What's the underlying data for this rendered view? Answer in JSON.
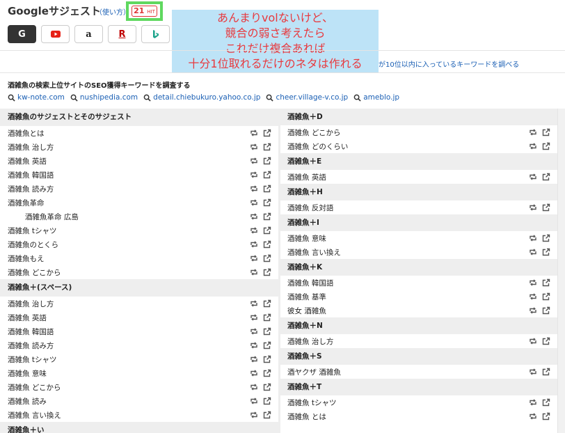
{
  "header": {
    "title": "Googleサジェスト",
    "howto": "（使い方）",
    "hit_count": "21",
    "hit_unit": "HIT"
  },
  "engines": [
    {
      "name": "google",
      "label": "G"
    },
    {
      "name": "youtube",
      "label": ""
    },
    {
      "name": "amazon",
      "label": "a"
    },
    {
      "name": "rakuten",
      "label": "R"
    },
    {
      "name": "bing",
      "label": ""
    }
  ],
  "callout": {
    "lines": [
      "あんまりvolないけど、",
      "競合の弱さ考えたら",
      "これだけ複合あれば",
      "十分1位取れるだけのネタは作れる"
    ]
  },
  "subline": {
    "text": "が10位以内に入っているキーワードを調べる"
  },
  "seo": {
    "title": "酒雑魚の検索上位サイトのSEO獲得キーワードを調査する",
    "sites": [
      "kw-note.com",
      "nushipedia.com",
      "detail.chiebukuro.yahoo.co.jp",
      "cheer.village-v.co.jp",
      "ameblo.jp"
    ]
  },
  "left": {
    "sections": [
      {
        "title": "酒雑魚のサジェストとそのサジェスト",
        "items": [
          {
            "text": "酒雑魚とは"
          },
          {
            "text": "酒雑魚 治し方"
          },
          {
            "text": "酒雑魚 英語"
          },
          {
            "text": "酒雑魚 韓国語"
          },
          {
            "text": "酒雑魚 読み方"
          },
          {
            "text": "酒雑魚革命"
          },
          {
            "text": "酒雑魚革命 広島",
            "indent": true
          },
          {
            "text": "酒雑魚 tシャツ"
          },
          {
            "text": "酒雑魚のとくら"
          },
          {
            "text": "酒雑魚もえ"
          },
          {
            "text": "酒雑魚 どこから"
          }
        ]
      },
      {
        "title": "酒雑魚＋(スペース)",
        "items": [
          {
            "text": "酒雑魚 治し方"
          },
          {
            "text": "酒雑魚 英語"
          },
          {
            "text": "酒雑魚 韓国語"
          },
          {
            "text": "酒雑魚 読み方"
          },
          {
            "text": "酒雑魚 tシャツ"
          },
          {
            "text": "酒雑魚 意味"
          },
          {
            "text": "酒雑魚 どこから"
          },
          {
            "text": "酒雑魚 読み"
          },
          {
            "text": "酒雑魚 言い換え"
          }
        ]
      },
      {
        "title": "酒雑魚＋い",
        "items": []
      }
    ]
  },
  "right": {
    "sections": [
      {
        "title": "酒雑魚＋D",
        "items": [
          {
            "text": "酒雑魚 どこから"
          },
          {
            "text": "酒雑魚 どのくらい"
          }
        ]
      },
      {
        "title": "酒雑魚＋E",
        "items": [
          {
            "text": "酒雑魚 英語"
          }
        ]
      },
      {
        "title": "酒雑魚＋H",
        "items": [
          {
            "text": "酒雑魚 反対語"
          }
        ]
      },
      {
        "title": "酒雑魚＋I",
        "items": [
          {
            "text": "酒雑魚 意味"
          },
          {
            "text": "酒雑魚 言い換え"
          }
        ]
      },
      {
        "title": "酒雑魚＋K",
        "items": [
          {
            "text": "酒雑魚 韓国語"
          },
          {
            "text": "酒雑魚 基準"
          },
          {
            "text": "彼女 酒雑魚"
          }
        ]
      },
      {
        "title": "酒雑魚＋N",
        "items": [
          {
            "text": "酒雑魚 治し方"
          }
        ]
      },
      {
        "title": "酒雑魚＋S",
        "items": [
          {
            "text": "酒ヤクザ 酒雑魚"
          }
        ]
      },
      {
        "title": "酒雑魚＋T",
        "items": [
          {
            "text": "酒雑魚 tシャツ"
          },
          {
            "text": "酒雑魚 とは"
          }
        ]
      }
    ]
  },
  "icons": {
    "row_action_1": "retweet-icon",
    "row_action_2": "external-link-icon",
    "site_icon": "search-icon"
  }
}
